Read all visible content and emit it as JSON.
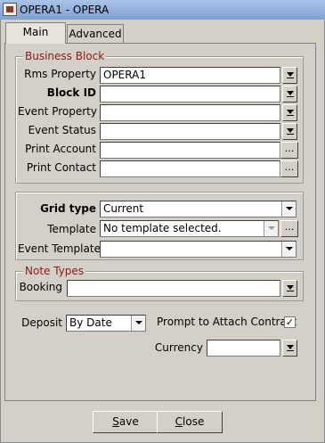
{
  "window": {
    "title": "OPERA1 - OPERA"
  },
  "tabs": [
    {
      "label": "Main",
      "active": true
    },
    {
      "label": "Advanced",
      "active": false
    }
  ],
  "business_block": {
    "legend": "Business Block",
    "rms_property": {
      "label": "Rms Property",
      "value": "OPERA1"
    },
    "block_id": {
      "label": "Block ID",
      "value": ""
    },
    "event_property": {
      "label": "Event Property",
      "value": ""
    },
    "event_status": {
      "label": "Event Status",
      "value": ""
    },
    "print_account": {
      "label": "Print Account",
      "value": ""
    },
    "print_contact": {
      "label": "Print Contact",
      "value": ""
    }
  },
  "grid": {
    "grid_type": {
      "label": "Grid type",
      "value": "Current"
    },
    "template": {
      "label": "Template",
      "value": "No template selected."
    },
    "event_template": {
      "label": "Event Template",
      "value": ""
    }
  },
  "note_types": {
    "legend": "Note Types",
    "booking": {
      "label": "Booking",
      "value": ""
    }
  },
  "deposit": {
    "label": "Deposit",
    "value": "By Date"
  },
  "prompt_contract": {
    "label": "Prompt to Attach Contract",
    "checked": true,
    "mark": "✓"
  },
  "currency": {
    "label": "Currency",
    "value": ""
  },
  "buttons": {
    "save": "Save",
    "save_rest": "ave",
    "save_mn": "S",
    "close": "Close",
    "close_mn": "C",
    "close_rest": "lose"
  },
  "ui": {
    "dots": "...",
    "ellipsis_icon": "ellipsis-icon",
    "lov_icon": "down-arrow-bar-icon",
    "dropdown_icon": "chevron-down-icon"
  }
}
